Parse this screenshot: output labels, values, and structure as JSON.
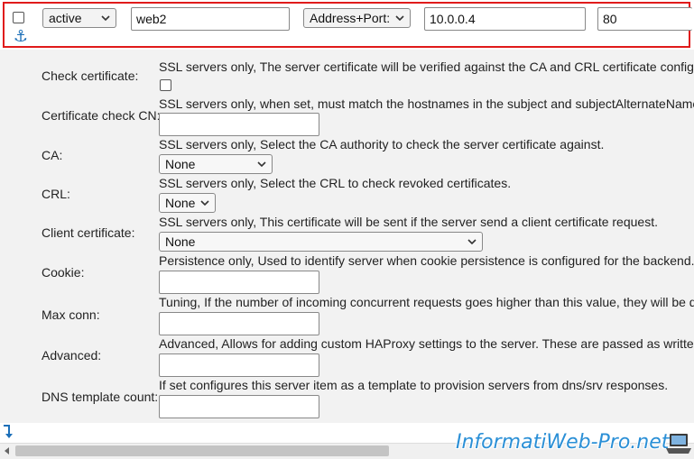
{
  "server_row": {
    "status_value": "active",
    "name_value": "web2",
    "type_value": "Address+Port:",
    "address_value": "10.0.0.4",
    "port_value": "80"
  },
  "fields": [
    {
      "label": "Check certificate:",
      "description": "SSL servers only, The server certificate will be verified against the CA and CRL certificate configu"
    },
    {
      "label": "Certificate check CN:",
      "description": "SSL servers only, when set, must match the hostnames in the subject and subjectAlternateName",
      "value": ""
    },
    {
      "label": "CA:",
      "description": "SSL servers only, Select the CA authority to check the server certificate against.",
      "value": "None"
    },
    {
      "label": "CRL:",
      "description": "SSL servers only, Select the CRL to check revoked certificates.",
      "value": "None"
    },
    {
      "label": "Client certificate:",
      "description": "SSL servers only, This certificate will be sent if the server send a client certificate request.",
      "value": "None"
    },
    {
      "label": "Cookie:",
      "description": "Persistence only, Used to identify server when cookie persistence is configured for the backend.",
      "value": ""
    },
    {
      "label": "Max conn:",
      "description": "Tuning, If the number of incoming concurrent requests goes higher than this value, they will be q",
      "value": ""
    },
    {
      "label": "Advanced:",
      "description": "Advanced, Allows for adding custom HAProxy settings to the server. These are passed as writte",
      "value": ""
    },
    {
      "label": "DNS template count:",
      "description": "If set configures this server item as a template to provision servers from dns/srv responses.",
      "value": ""
    }
  ],
  "watermark": "InformatiWeb-Pro.net",
  "icons": {
    "anchor": "anchor-icon",
    "chevron": "chevron-down-icon",
    "arrow": "arrow-down-icon",
    "laptop": "laptop-icon"
  },
  "colors": {
    "highlight_border": "#e01b1b",
    "anchor_blue": "#1c6fb8",
    "details_bg": "#f2f2f2",
    "watermark_blue": "#2a8fd6"
  }
}
